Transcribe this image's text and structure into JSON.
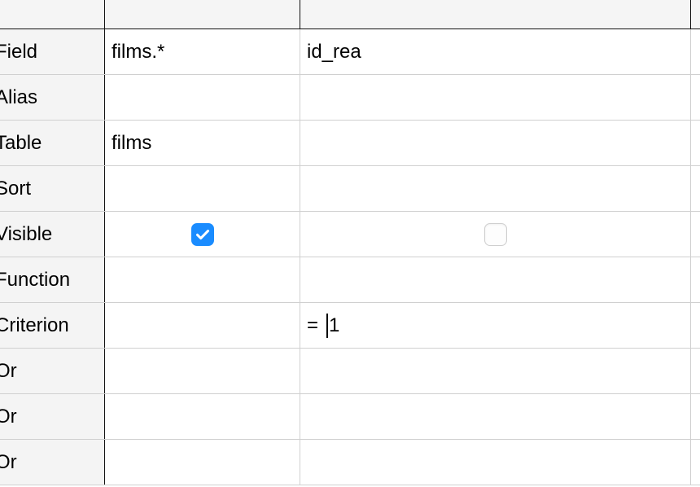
{
  "grid": {
    "header": {
      "label_column_header": "",
      "column_headers": [
        "",
        "",
        ""
      ]
    },
    "row_labels": [
      "Field",
      "Alias",
      "Table",
      "Sort",
      "Visible",
      "Function",
      "Criterion",
      "Or",
      "Or",
      "Or"
    ],
    "columns": [
      {
        "field": "films.*",
        "alias": "",
        "table": "films",
        "sort": "",
        "visible_checked": true,
        "function": "",
        "criterion": "",
        "or1": "",
        "or2": "",
        "or3": ""
      },
      {
        "field": "id_rea",
        "alias": "",
        "table": "",
        "sort": "",
        "visible_checked": false,
        "function": "",
        "criterion_operator": "=",
        "criterion_value": "1",
        "criterion_caret": true,
        "or1": "",
        "or2": "",
        "or3": ""
      },
      {
        "field": "",
        "alias": "",
        "table": "",
        "sort": "",
        "function": "",
        "criterion": "",
        "or1": "",
        "or2": "",
        "or3": ""
      }
    ],
    "icons": {
      "checked": "checkbox-checked-icon",
      "unchecked": "checkbox-unchecked-icon",
      "caret": "text-cursor-caret"
    },
    "colors": {
      "checkbox_accent": "#1a8cff",
      "header_background": "#f5f5f5",
      "label_background": "#f4f4f4",
      "cell_background": "#ffffff",
      "grid_line_light": "#d0d0d0",
      "grid_line_dark": "#111111",
      "text": "#000000"
    }
  }
}
